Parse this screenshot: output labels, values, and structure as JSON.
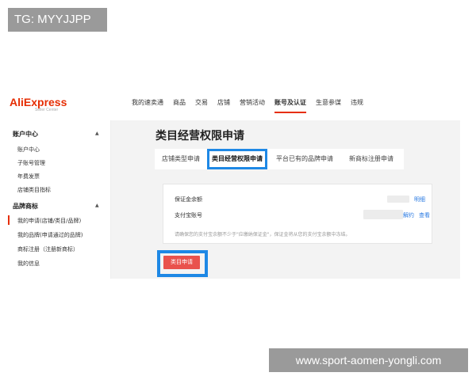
{
  "watermarks": {
    "tag": "TG: MYYJJPP",
    "site": "www.sport-aomen-yongli.com"
  },
  "brand": {
    "logo": "AliExpress",
    "subtitle": "Seller Center",
    "color": "#e62e04"
  },
  "nav": [
    {
      "label": "我的速卖通"
    },
    {
      "label": "商品"
    },
    {
      "label": "交易"
    },
    {
      "label": "店铺"
    },
    {
      "label": "营销活动"
    },
    {
      "label": "账号及认证",
      "active": true
    },
    {
      "label": "生意参谋"
    },
    {
      "label": "违规"
    }
  ],
  "sidebar": {
    "groups": [
      {
        "title": "账户中心",
        "items": [
          "账户中心",
          "子账号管理",
          "年费发票",
          "店铺类目指标"
        ]
      },
      {
        "title": "品牌商标",
        "items": [
          "我的申请(店铺/类目/品牌)",
          "我的品牌(申请通过的品牌)",
          "商标注册（注册新商标）",
          "我的信息"
        ],
        "active_index": 0
      }
    ]
  },
  "main": {
    "title": "类目经营权限申请",
    "tabs": [
      {
        "label": "店铺类型申请"
      },
      {
        "label": "类目经营权限申请",
        "active": true
      },
      {
        "label": "平台已有的品牌申请"
      },
      {
        "label": "新商标注册申请"
      }
    ],
    "panel": {
      "deposit_label": "保证金余额",
      "deposit_link": "明细",
      "alipay_label": "支付宝账号",
      "unbind_link": "解约",
      "view_link": "查看",
      "note": "请确保您的支付宝余额不少于\"应缴纳保证金\"，保证金将从您的支付宝余额中冻结。"
    },
    "apply_button": "类目申请"
  },
  "colors": {
    "highlight": "#1e88e5",
    "apply": "#e9524d",
    "link": "#2a7ae2"
  }
}
